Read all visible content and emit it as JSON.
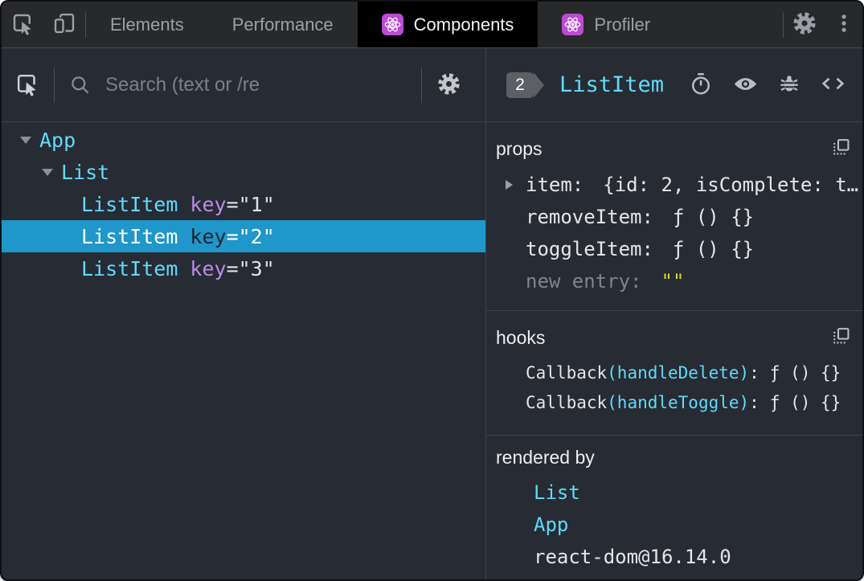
{
  "tabbar": {
    "tabs": [
      {
        "label": "Elements"
      },
      {
        "label": "Performance"
      },
      {
        "label": "Components"
      },
      {
        "label": "Profiler"
      }
    ]
  },
  "left": {
    "search_placeholder": "Search (text or /re",
    "tree": [
      {
        "name": "App",
        "expanded": true
      },
      {
        "name": "List",
        "expanded": true
      },
      {
        "name": "ListItem",
        "attr": "key",
        "value": "=\"1\"",
        "selected": false
      },
      {
        "name": "ListItem",
        "attr": "key",
        "value": "=\"2\"",
        "selected": true
      },
      {
        "name": "ListItem",
        "attr": "key",
        "value": "=\"3\"",
        "selected": false
      }
    ]
  },
  "right": {
    "badge": "2",
    "title": "ListItem",
    "props": {
      "label": "props",
      "rows": [
        {
          "name": "item:",
          "value": "{id: 2, isComplete: t…"
        },
        {
          "name": "removeItem:",
          "value": "ƒ () {}"
        },
        {
          "name": "toggleItem:",
          "value": "ƒ () {}"
        },
        {
          "name": "new entry:",
          "value": "\"\""
        }
      ]
    },
    "hooks": {
      "label": "hooks",
      "rows": [
        {
          "fn": "Callback",
          "arg": "(handleDelete)",
          "sep": ":",
          "value": "ƒ () {}"
        },
        {
          "fn": "Callback",
          "arg": "(handleToggle)",
          "sep": ":",
          "value": "ƒ () {}"
        }
      ]
    },
    "rendered_by": {
      "label": "rendered by",
      "items": [
        "List",
        "App",
        "react-dom@16.14.0"
      ]
    }
  },
  "icons": {
    "tabbar": [
      "inspect-cursor-icon",
      "device-toolbar-icon",
      "react-logo-icon",
      "gear-icon",
      "more-vertical-icon"
    ],
    "left_toolbar": [
      "inspect-cursor-icon",
      "search-icon",
      "gear-icon"
    ],
    "right_header": [
      "timer-icon",
      "eye-icon",
      "bug-icon",
      "code-icon"
    ],
    "sections": [
      "copy-icon"
    ]
  },
  "colors": {
    "component_cyan": "#61dafb",
    "selection_blue": "#1f97ca",
    "attr_purple": "#b88ee8",
    "string_yellow": "#e0da2e",
    "react_logo_purple": "#bb4bd3",
    "active_tab_bg": "#000000",
    "panel_bg": "#272b33",
    "tabbar_bg": "#28292b"
  }
}
